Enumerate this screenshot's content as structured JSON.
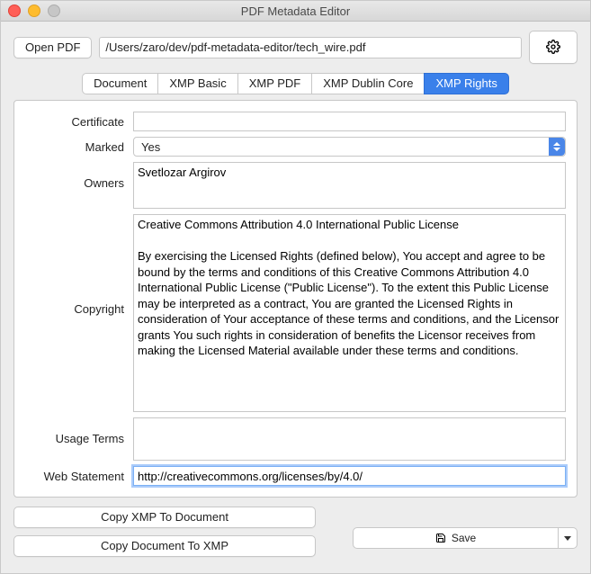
{
  "window": {
    "title": "PDF Metadata Editor"
  },
  "toolbar": {
    "open_label": "Open PDF",
    "path": "/Users/zaro/dev/pdf-metadata-editor/tech_wire.pdf"
  },
  "tabs": [
    {
      "label": "Document",
      "selected": false
    },
    {
      "label": "XMP Basic",
      "selected": false
    },
    {
      "label": "XMP PDF",
      "selected": false
    },
    {
      "label": "XMP Dublin Core",
      "selected": false
    },
    {
      "label": "XMP Rights",
      "selected": true
    }
  ],
  "form": {
    "certificate": {
      "label": "Certificate",
      "value": ""
    },
    "marked": {
      "label": "Marked",
      "value": "Yes"
    },
    "owners": {
      "label": "Owners",
      "value": "Svetlozar Argirov"
    },
    "copyright": {
      "label": "Copyright",
      "value": "Creative Commons Attribution 4.0 International Public License\n\nBy exercising the Licensed Rights (defined below), You accept and agree to be bound by the terms and conditions of this Creative Commons Attribution 4.0 International Public License (\"Public License\"). To the extent this Public License may be interpreted as a contract, You are granted the Licensed Rights in consideration of Your acceptance of these terms and conditions, and the Licensor grants You such rights in consideration of benefits the Licensor receives from making the Licensed Material available under these terms and conditions."
    },
    "usage": {
      "label": "Usage Terms",
      "value": ""
    },
    "web": {
      "label": "Web Statement",
      "value": "http://creativecommons.org/licenses/by/4.0/"
    }
  },
  "buttons": {
    "copy_xmp_to_doc": "Copy XMP To Document",
    "copy_doc_to_xmp": "Copy Document To XMP",
    "save": "Save"
  }
}
